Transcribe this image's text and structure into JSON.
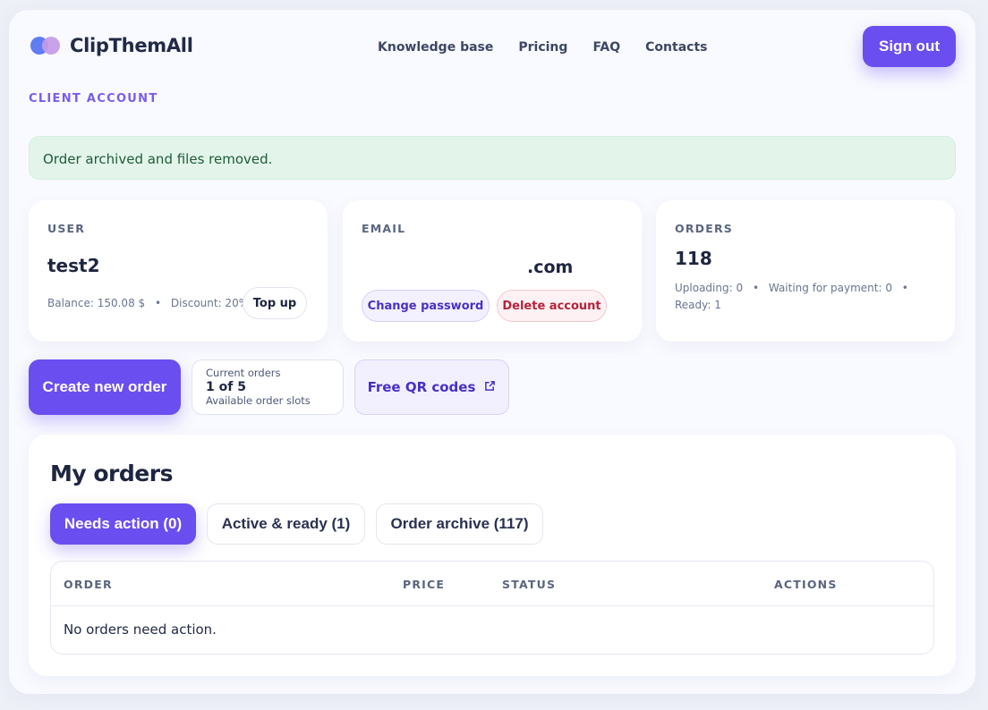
{
  "brand": {
    "name": "ClipThemAll"
  },
  "nav": [
    "Knowledge base",
    "Pricing",
    "FAQ",
    "Contacts"
  ],
  "header": {
    "signout_label": "Sign out"
  },
  "section_label": "CLIENT ACCOUNT",
  "alert": {
    "message": "Order archived and files removed."
  },
  "user_card": {
    "label": "USER",
    "username": "test2",
    "balance": "Balance: 150.08 $",
    "discount": "Discount: 20%",
    "topup_label": "Top up"
  },
  "email_card": {
    "label": "EMAIL",
    "email_visible": ".com",
    "change_password_label": "Change password",
    "delete_account_label": "Delete account"
  },
  "orders_card": {
    "label": "ORDERS",
    "count": "118",
    "uploading": "Uploading: 0",
    "waiting": "Waiting for payment: 0",
    "ready": "Ready: 1"
  },
  "actions": {
    "create_order_label": "Create new order",
    "slots_title": "Current orders",
    "slots_value": "1 of 5",
    "slots_subtitle": "Available order slots",
    "qr_label": "Free QR codes"
  },
  "my_orders": {
    "title": "My orders",
    "tabs": [
      {
        "label": "Needs action (0)",
        "active": true
      },
      {
        "label": "Active & ready (1)",
        "active": false
      },
      {
        "label": "Order archive (117)",
        "active": false
      }
    ],
    "columns": [
      "ORDER",
      "PRICE",
      "STATUS",
      "ACTIONS"
    ],
    "empty_message": "No orders need action."
  },
  "colors": {
    "accent": "#6b4ef0",
    "success_bg": "#e3f5ea",
    "danger": "#b4233a"
  },
  "icons": {
    "external_link": "external-link-icon",
    "bullet": "•"
  }
}
